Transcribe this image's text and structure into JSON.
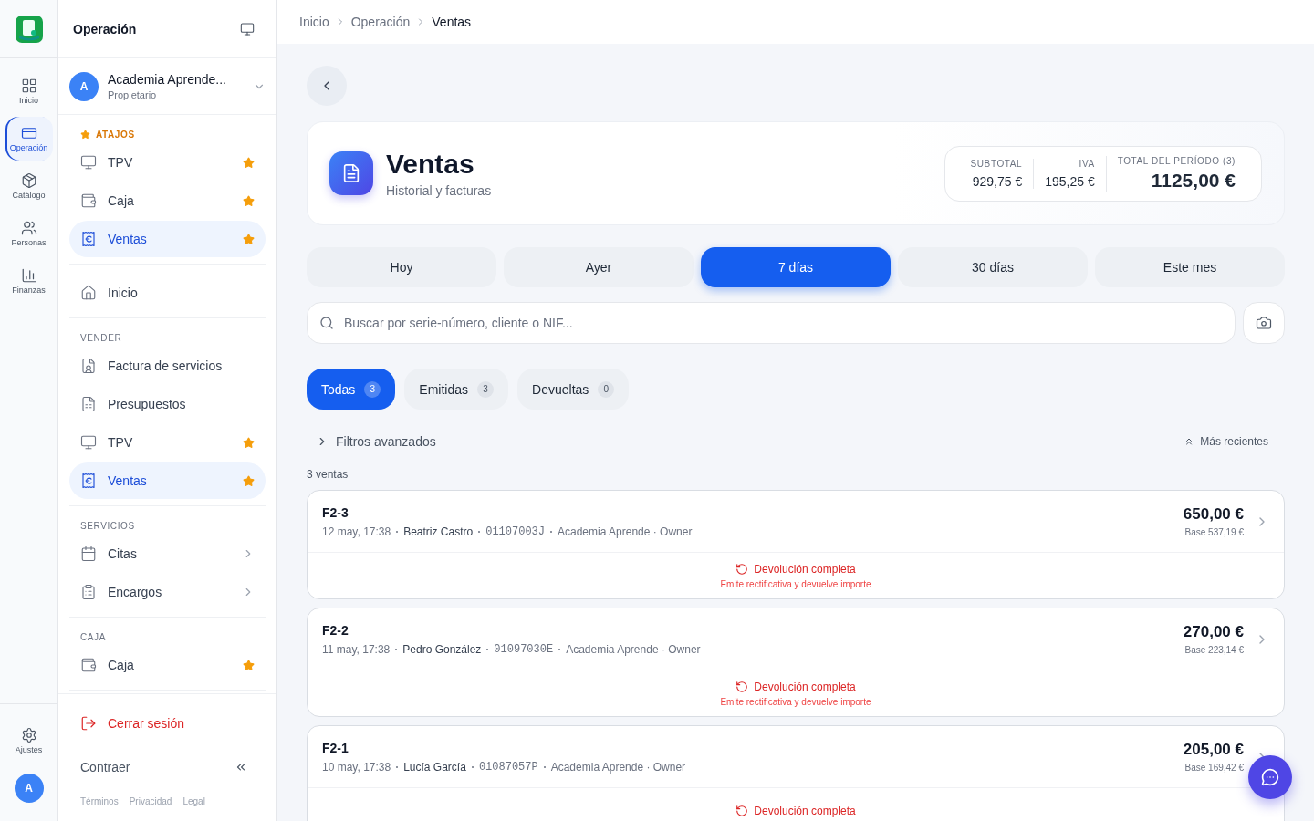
{
  "rail": {
    "items": [
      {
        "label": "Inicio",
        "kind": "grid",
        "selected": false
      },
      {
        "label": "Operación",
        "kind": "card",
        "selected": true
      },
      {
        "label": "Catálogo",
        "kind": "box",
        "selected": false
      },
      {
        "label": "Personas",
        "kind": "people",
        "selected": false
      },
      {
        "label": "Finanzas",
        "kind": "chart",
        "selected": false
      }
    ],
    "settings": "Ajustes",
    "avatar": "A"
  },
  "sidebar": {
    "title": "Operación",
    "account": {
      "avatar": "A",
      "name": "Academia Aprende...",
      "role": "Propietario"
    },
    "sections": [
      {
        "heading": "ATAJOS",
        "kind": "shortcuts",
        "items": [
          {
            "label": "TPV",
            "kind": "monitor",
            "starred": true,
            "expandable": false,
            "selected": false
          },
          {
            "label": "Caja",
            "kind": "wallet",
            "starred": true,
            "expandable": false,
            "selected": false
          },
          {
            "label": "Ventas",
            "kind": "receipt",
            "starred": true,
            "expandable": false,
            "selected": true
          }
        ]
      },
      {
        "kind": "plain",
        "items": [
          {
            "label": "Inicio",
            "kind": "home",
            "starred": false,
            "expandable": false,
            "selected": false
          }
        ]
      },
      {
        "heading": "VENDER",
        "kind": "group",
        "items": [
          {
            "label": "Factura de servicios",
            "kind": "invoice",
            "starred": false,
            "expandable": false,
            "selected": false
          },
          {
            "label": "Presupuestos",
            "kind": "sheet",
            "starred": false,
            "expandable": false,
            "selected": false
          },
          {
            "label": "TPV",
            "kind": "monitor",
            "starred": true,
            "expandable": false,
            "selected": false
          },
          {
            "label": "Ventas",
            "kind": "receipt",
            "starred": true,
            "expandable": false,
            "selected": true
          }
        ]
      },
      {
        "heading": "SERVICIOS",
        "kind": "group",
        "items": [
          {
            "label": "Citas",
            "kind": "calendar",
            "starred": false,
            "expandable": true,
            "selected": false
          },
          {
            "label": "Encargos",
            "kind": "clipboard",
            "starred": false,
            "expandable": true,
            "selected": false
          }
        ]
      },
      {
        "heading": "CAJA",
        "kind": "group",
        "items": [
          {
            "label": "Caja",
            "kind": "wallet",
            "starred": true,
            "expandable": false,
            "selected": false
          }
        ]
      }
    ],
    "logout": "Cerrar sesión",
    "collapse": "Contraer",
    "links": [
      "Términos",
      "Privacidad",
      "Legal"
    ]
  },
  "breadcrumb": [
    "Inicio",
    "Operación",
    "Ventas"
  ],
  "header": {
    "title": "Ventas",
    "subtitle": "Historial y facturas",
    "stats": [
      {
        "label": "SUBTOTAL",
        "value": "929,75 €",
        "kind": "small"
      },
      {
        "label": "IVA",
        "value": "195,25 €",
        "kind": "small"
      },
      {
        "label": "TOTAL DEL PERÍODO (3)",
        "value": "1125,00 €",
        "kind": "total"
      }
    ]
  },
  "periods": [
    {
      "label": "Hoy",
      "selected": false
    },
    {
      "label": "Ayer",
      "selected": false
    },
    {
      "label": "7 días",
      "selected": true
    },
    {
      "label": "30 días",
      "selected": false
    },
    {
      "label": "Este mes",
      "selected": false
    }
  ],
  "search": {
    "placeholder": "Buscar por serie-número, cliente o NIF..."
  },
  "filters": [
    {
      "label": "Todas",
      "count": "3",
      "selected": true
    },
    {
      "label": "Emitidas",
      "count": "3",
      "selected": false
    },
    {
      "label": "Devueltas",
      "count": "0",
      "selected": false
    }
  ],
  "advanced": "Filtros avanzados",
  "sort": "Más recientes",
  "count": "3 ventas",
  "sales": [
    {
      "number": "F2-3",
      "date": "12 may, 17:38",
      "customer": "Beatriz Castro",
      "nif": "01107003J",
      "store": "Academia Aprende · Owner",
      "total": "650,00 €",
      "base": "Base 537,19 €",
      "action": "Devolución completa",
      "hint": "Emite rectificativa y devuelve importe"
    },
    {
      "number": "F2-2",
      "date": "11 may, 17:38",
      "customer": "Pedro González",
      "nif": "01097030E",
      "store": "Academia Aprende · Owner",
      "total": "270,00 €",
      "base": "Base 223,14 €",
      "action": "Devolución completa",
      "hint": "Emite rectificativa y devuelve importe"
    },
    {
      "number": "F2-1",
      "date": "10 may, 17:38",
      "customer": "Lucía García",
      "nif": "01087057P",
      "store": "Academia Aprende · Owner",
      "total": "205,00 €",
      "base": "Base 169,42 €",
      "action": "Devolución completa"
    }
  ]
}
